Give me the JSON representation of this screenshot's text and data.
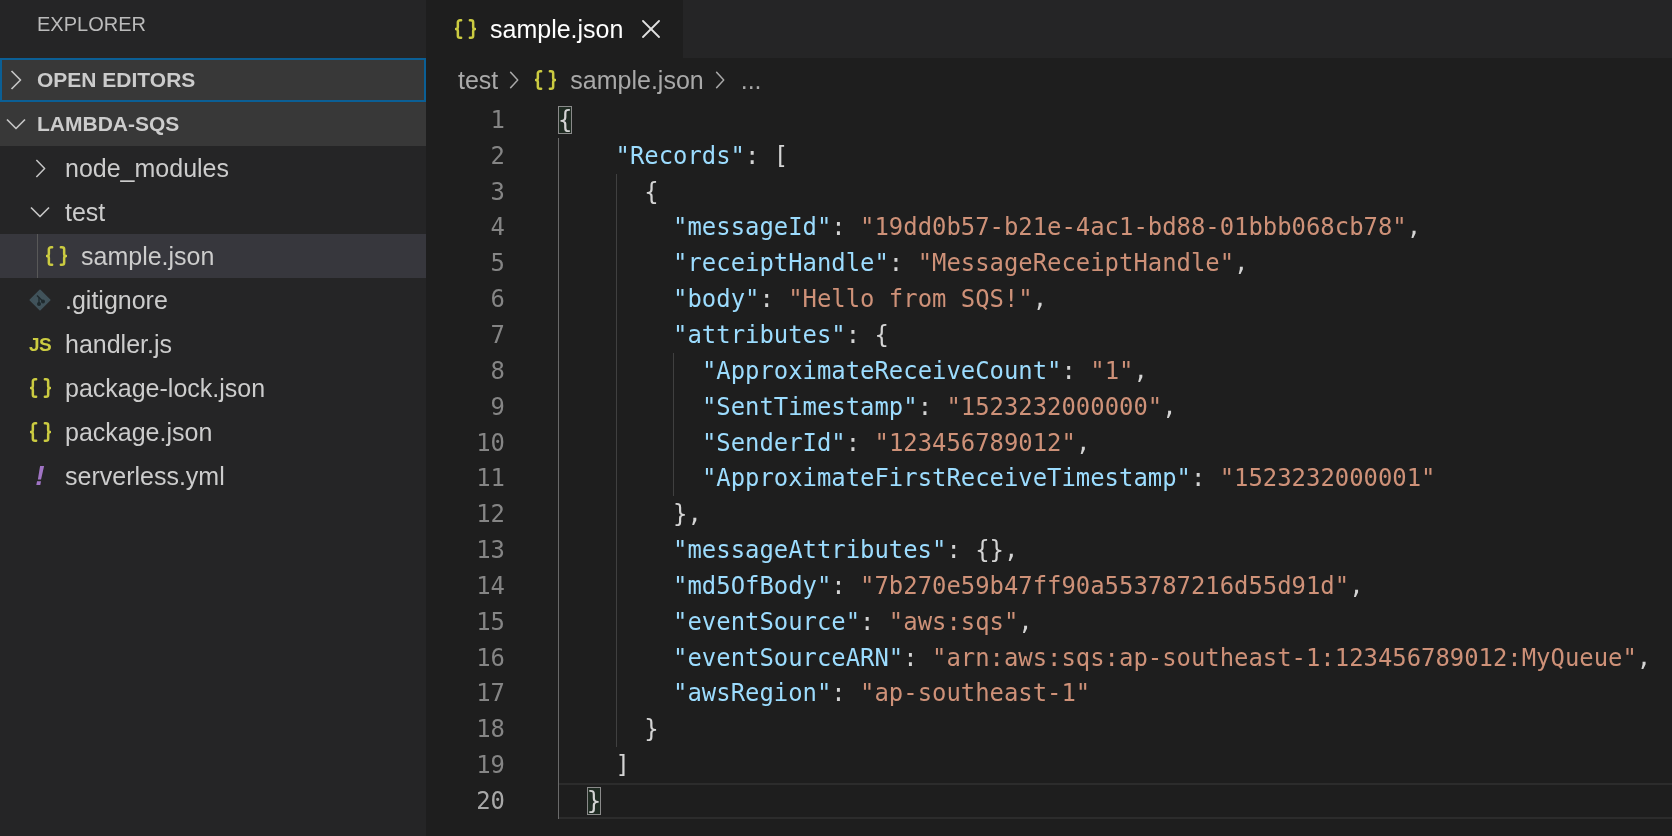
{
  "sidebar": {
    "title": "EXPLORER",
    "sections": [
      {
        "title": "OPEN EDITORS",
        "expanded": false,
        "focused": true
      },
      {
        "title": "LAMBDA-SQS",
        "expanded": true,
        "focused": false,
        "items": [
          {
            "label": "node_modules",
            "kind": "folder",
            "expanded": false,
            "selected": false
          },
          {
            "label": "test",
            "kind": "folder",
            "expanded": true,
            "selected": false,
            "children": [
              {
                "label": "sample.json",
                "kind": "json",
                "selected": true
              }
            ]
          },
          {
            "label": ".gitignore",
            "kind": "git",
            "selected": false
          },
          {
            "label": "handler.js",
            "kind": "js",
            "badge": "JS",
            "selected": false
          },
          {
            "label": "package-lock.json",
            "kind": "json",
            "selected": false
          },
          {
            "label": "package.json",
            "kind": "json",
            "selected": false
          },
          {
            "label": "serverless.yml",
            "kind": "yaml",
            "badge": "!",
            "selected": false
          }
        ]
      }
    ]
  },
  "tabs": [
    {
      "label": "sample.json",
      "kind": "json",
      "selected": true
    }
  ],
  "breadcrumb": [
    {
      "label": "test",
      "kind": "folder"
    },
    {
      "label": "sample.json",
      "kind": "json"
    },
    {
      "label": "...",
      "kind": "symbol"
    }
  ],
  "editor": {
    "lines": [
      {
        "number": "1",
        "current": false,
        "tokens": [
          {
            "kind": "bracket",
            "text": "{"
          }
        ]
      },
      {
        "number": "2",
        "current": false,
        "tokens": [
          {
            "kind": "key",
            "text": "    \"Records\""
          },
          {
            "kind": "punct",
            "text": ": ["
          }
        ]
      },
      {
        "number": "3",
        "current": false,
        "tokens": [
          {
            "kind": "punct",
            "text": "      {"
          }
        ]
      },
      {
        "number": "4",
        "current": false,
        "tokens": [
          {
            "kind": "key",
            "text": "        \"messageId\""
          },
          {
            "kind": "punct",
            "text": ": "
          },
          {
            "kind": "string",
            "text": "\"19dd0b57-b21e-4ac1-bd88-01bbb068cb78\""
          },
          {
            "kind": "punct",
            "text": ","
          }
        ]
      },
      {
        "number": "5",
        "current": false,
        "tokens": [
          {
            "kind": "key",
            "text": "        \"receiptHandle\""
          },
          {
            "kind": "punct",
            "text": ": "
          },
          {
            "kind": "string",
            "text": "\"MessageReceiptHandle\""
          },
          {
            "kind": "punct",
            "text": ","
          }
        ]
      },
      {
        "number": "6",
        "current": false,
        "tokens": [
          {
            "kind": "key",
            "text": "        \"body\""
          },
          {
            "kind": "punct",
            "text": ": "
          },
          {
            "kind": "string",
            "text": "\"Hello from SQS!\""
          },
          {
            "kind": "punct",
            "text": ","
          }
        ]
      },
      {
        "number": "7",
        "current": false,
        "tokens": [
          {
            "kind": "key",
            "text": "        \"attributes\""
          },
          {
            "kind": "punct",
            "text": ": {"
          }
        ]
      },
      {
        "number": "8",
        "current": false,
        "tokens": [
          {
            "kind": "key",
            "text": "          \"ApproximateReceiveCount\""
          },
          {
            "kind": "punct",
            "text": ": "
          },
          {
            "kind": "string",
            "text": "\"1\""
          },
          {
            "kind": "punct",
            "text": ","
          }
        ]
      },
      {
        "number": "9",
        "current": false,
        "tokens": [
          {
            "kind": "key",
            "text": "          \"SentTimestamp\""
          },
          {
            "kind": "punct",
            "text": ": "
          },
          {
            "kind": "string",
            "text": "\"1523232000000\""
          },
          {
            "kind": "punct",
            "text": ","
          }
        ]
      },
      {
        "number": "10",
        "current": false,
        "tokens": [
          {
            "kind": "key",
            "text": "          \"SenderId\""
          },
          {
            "kind": "punct",
            "text": ": "
          },
          {
            "kind": "string",
            "text": "\"123456789012\""
          },
          {
            "kind": "punct",
            "text": ","
          }
        ]
      },
      {
        "number": "11",
        "current": false,
        "tokens": [
          {
            "kind": "key",
            "text": "          \"ApproximateFirstReceiveTimestamp\""
          },
          {
            "kind": "punct",
            "text": ": "
          },
          {
            "kind": "string",
            "text": "\"1523232000001\""
          }
        ]
      },
      {
        "number": "12",
        "current": false,
        "tokens": [
          {
            "kind": "punct",
            "text": "        },"
          }
        ]
      },
      {
        "number": "13",
        "current": false,
        "tokens": [
          {
            "kind": "key",
            "text": "        \"messageAttributes\""
          },
          {
            "kind": "punct",
            "text": ": {},"
          }
        ]
      },
      {
        "number": "14",
        "current": false,
        "tokens": [
          {
            "kind": "key",
            "text": "        \"md5OfBody\""
          },
          {
            "kind": "punct",
            "text": ": "
          },
          {
            "kind": "string",
            "text": "\"7b270e59b47ff90a553787216d55d91d\""
          },
          {
            "kind": "punct",
            "text": ","
          }
        ]
      },
      {
        "number": "15",
        "current": false,
        "tokens": [
          {
            "kind": "key",
            "text": "        \"eventSource\""
          },
          {
            "kind": "punct",
            "text": ": "
          },
          {
            "kind": "string",
            "text": "\"aws:sqs\""
          },
          {
            "kind": "punct",
            "text": ","
          }
        ]
      },
      {
        "number": "16",
        "current": false,
        "tokens": [
          {
            "kind": "key",
            "text": "        \"eventSourceARN\""
          },
          {
            "kind": "punct",
            "text": ": "
          },
          {
            "kind": "string",
            "text": "\"arn:aws:sqs:ap-southeast-1:123456789012:MyQueue\""
          },
          {
            "kind": "punct",
            "text": ","
          }
        ]
      },
      {
        "number": "17",
        "current": false,
        "tokens": [
          {
            "kind": "key",
            "text": "        \"awsRegion\""
          },
          {
            "kind": "punct",
            "text": ": "
          },
          {
            "kind": "string",
            "text": "\"ap-southeast-1\""
          }
        ]
      },
      {
        "number": "18",
        "current": false,
        "tokens": [
          {
            "kind": "punct",
            "text": "      }"
          }
        ]
      },
      {
        "number": "19",
        "current": false,
        "tokens": [
          {
            "kind": "punct",
            "text": "    ]"
          }
        ]
      },
      {
        "number": "20",
        "current": true,
        "tokens": [
          {
            "kind": "bracket",
            "text": "  }"
          }
        ]
      }
    ]
  }
}
